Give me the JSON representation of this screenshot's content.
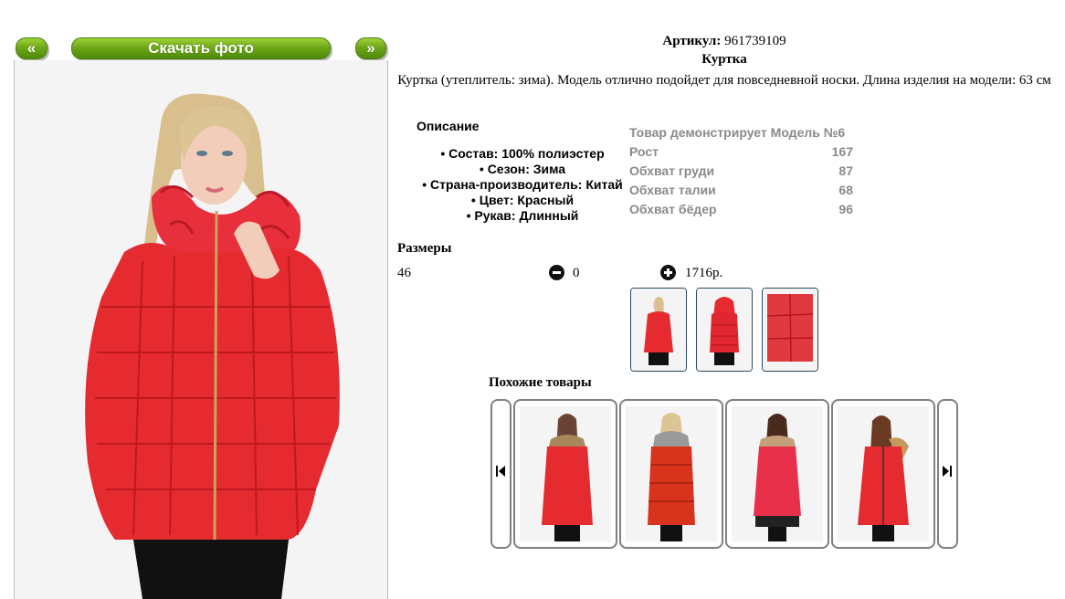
{
  "controls": {
    "prev_label": "«",
    "download_label": "Скачать фото",
    "next_label": "»"
  },
  "product": {
    "sku_label": "Артикул:",
    "sku_value": "961739109",
    "title": "Куртка",
    "description": "Куртка (утеплитель: зима). Модель отлично подойдет для повседневной носки. Длина изделия на модели: 63 см"
  },
  "details": {
    "heading": "Описание",
    "items": [
      "Состав: 100% полиэстер",
      "Сезон: Зима",
      "Страна-производитель: Китай",
      "Цвет: Красный",
      "Рукав: Длинный"
    ]
  },
  "model": {
    "heading": "Товар демонстрирует Модель №6",
    "rows": [
      {
        "label": "Рост",
        "value": "167"
      },
      {
        "label": "Обхват груди",
        "value": "87"
      },
      {
        "label": "Обхват талии",
        "value": "68"
      },
      {
        "label": "Обхват бёдер",
        "value": "96"
      }
    ]
  },
  "sizes": {
    "heading": "Размеры",
    "size": "46",
    "quantity": "0",
    "price": "1716р."
  },
  "icons": {
    "minus": "minus-circle-icon",
    "plus": "plus-circle-icon",
    "carousel_prev": "skip-back-icon",
    "carousel_next": "skip-forward-icon"
  },
  "similar": {
    "heading": "Похожие товары"
  },
  "colors": {
    "accent_green": "#6fa718",
    "jacket_red": "#e52a30"
  }
}
